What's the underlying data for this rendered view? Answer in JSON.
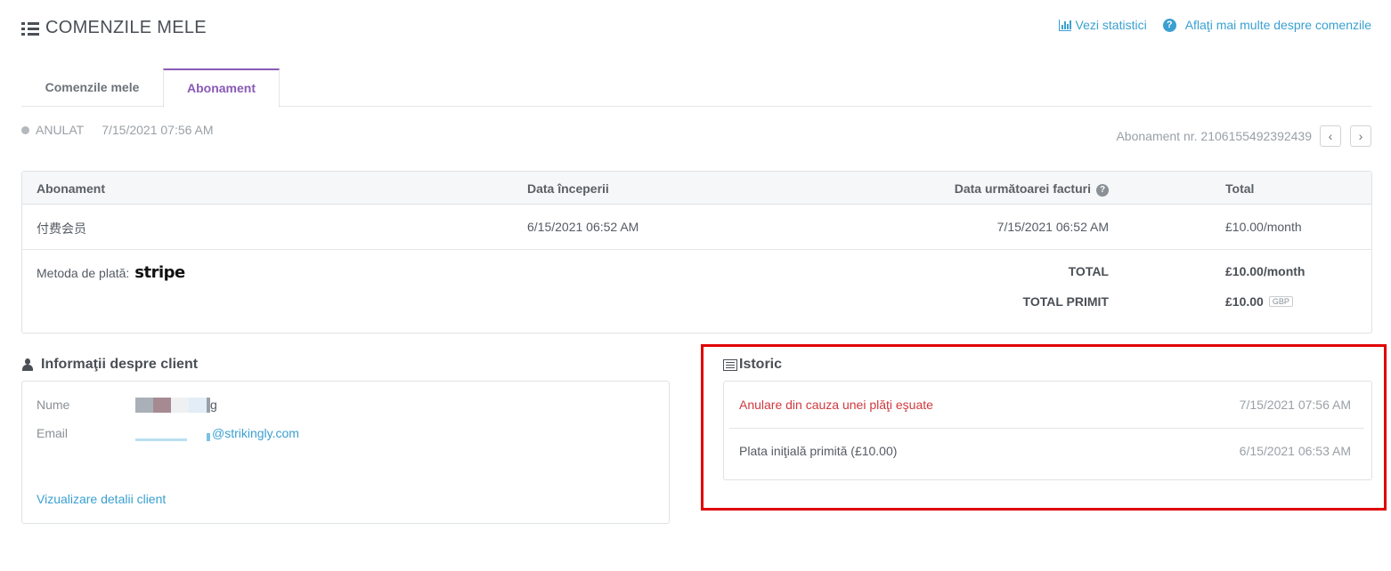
{
  "header": {
    "title": "COMENZILE MELE",
    "stats_link": "Vezi statistici",
    "help_link": "Aflaţi mai multe despre comenzile"
  },
  "tabs": [
    {
      "label": "Comenzile mele",
      "active": false
    },
    {
      "label": "Abonament",
      "active": true
    }
  ],
  "subscription": {
    "status": "ANULAT",
    "status_date": "7/15/2021 07:56 AM",
    "number_label": "Abonament nr. 2106155492392439"
  },
  "table": {
    "headers": {
      "subscription": "Abonament",
      "start_date": "Data începerii",
      "next_invoice": "Data următoarei facturi",
      "total": "Total"
    },
    "row": {
      "name": "付费会员",
      "start_date": "6/15/2021 06:52 AM",
      "next_invoice": "7/15/2021 06:52 AM",
      "total": "£10.00/month"
    },
    "payment_method_label": "Metoda de plată:",
    "payment_provider": "stripe",
    "total_label": "TOTAL",
    "total_value": "£10.00/month",
    "received_label": "TOTAL PRIMIT",
    "received_value": "£10.00",
    "currency": "GBP"
  },
  "client": {
    "title": "Informaţii despre client",
    "name_label": "Nume",
    "name_visible_suffix": "g",
    "email_label": "Email",
    "email_visible_suffix": "@strikingly.com",
    "details_link": "Vizualizare detalii client"
  },
  "history": {
    "title": "Istoric",
    "items": [
      {
        "text": "Anulare din cauza unei plăţi eşuate",
        "date": "7/15/2021 07:56 AM",
        "color": "#d0393e"
      },
      {
        "text": "Plata iniţială primită (£10.00)",
        "date": "6/15/2021 06:53 AM",
        "color": "#555b62"
      }
    ]
  },
  "colors": {
    "accent_purple": "#8a5ab7",
    "link_blue": "#3aa0d0",
    "error_red": "#d0393e",
    "highlight_red": "#e00000"
  }
}
